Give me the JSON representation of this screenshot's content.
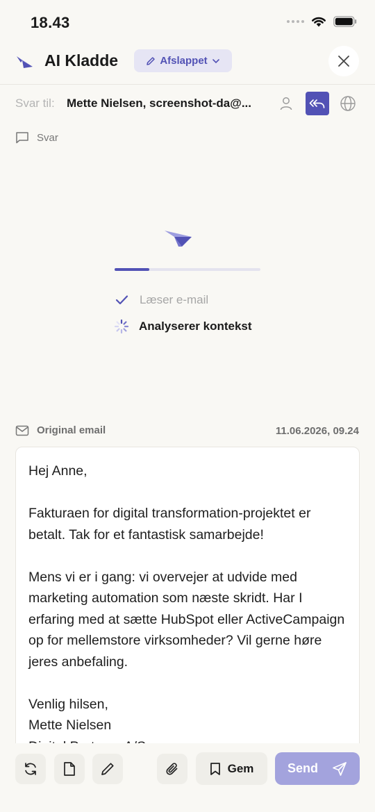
{
  "status_bar": {
    "time": "18.43"
  },
  "header": {
    "title": "AI Kladde",
    "mode_label": "Afslappet"
  },
  "reply": {
    "label": "Svar til:",
    "recipients": "Mette Nielsen, screenshot-da@..."
  },
  "compose": {
    "svar_label": "Svar"
  },
  "progress": {
    "fraction": 0.24,
    "steps": [
      {
        "label": "Læser e-mail",
        "state": "done"
      },
      {
        "label": "Analyserer kontekst",
        "state": "active"
      }
    ]
  },
  "original_email": {
    "label": "Original email",
    "date": "11.06.2026, 09.24",
    "paragraphs": [
      "Hej Anne,",
      "Fakturaen for digital transformation-projektet er betalt. Tak for et fantastisk samarbejde!",
      "Mens vi er i gang: vi overvejer at udvide med marketing automation som næste skridt. Har I erfaring med at sætte HubSpot eller ActiveCampaign op for mellemstore virksomheder? Vil gerne høre jeres anbefaling.",
      "Venlig hilsen,\nMette Nielsen\nDigital Partners A/S"
    ]
  },
  "toolbar": {
    "save_label": "Gem",
    "send_label": "Send"
  },
  "colors": {
    "accent": "#5252b5",
    "accent_light": "#e6e5f4",
    "send_disabled": "#a3a3dd",
    "background": "#f9f8f4"
  },
  "icons": [
    "wifi-icon",
    "battery-icon",
    "pencil-icon",
    "chevron-down-icon",
    "close-icon",
    "person-icon",
    "reply-all-icon",
    "globe-icon",
    "message-icon",
    "check-icon",
    "spinner-icon",
    "mail-icon",
    "refresh-icon",
    "document-icon",
    "paperclip-icon",
    "bookmark-icon",
    "send-icon"
  ]
}
